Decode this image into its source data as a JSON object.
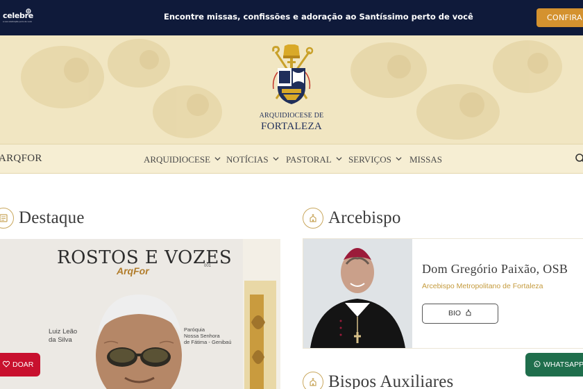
{
  "topbar": {
    "logo_text": "celebre",
    "logo_tagline": "a sua celebração perto de você",
    "promo_text": "Encontre missas, confissões e adoração ao Santíssimo perto de você",
    "cta_label": "CONFIRA"
  },
  "hero": {
    "org_line1": "ARQUIDIOCESE DE",
    "org_line2": "FORTALEZA"
  },
  "nav": {
    "brand": "ARQFOR",
    "items": [
      {
        "label": "ARQUIDIOCESE",
        "has_dropdown": true
      },
      {
        "label": "NOTÍCIAS",
        "has_dropdown": true
      },
      {
        "label": "PASTORAL",
        "has_dropdown": true
      },
      {
        "label": "SERVIÇOS",
        "has_dropdown": true
      },
      {
        "label": "MISSAS",
        "has_dropdown": false
      }
    ]
  },
  "sections": {
    "featured_title": "Destaque",
    "archbishop_title": "Arcebispo",
    "auxiliary_title": "Bispos Auxiliares"
  },
  "featured": {
    "title": "ROSTOS E VOZES",
    "subtitle": "ArqFor",
    "issue": "001",
    "person_name_line1": "Luiz Leão",
    "person_name_line2": "da Silva",
    "parish_line1": "Paróquia",
    "parish_line2": "Nossa Senhora",
    "parish_line3": "de Fátima - Genibaú"
  },
  "archbishop": {
    "name": "Dom Gregório Paixão, OSB",
    "role": "Arcebispo Metropolitano de Fortaleza",
    "bio_label": "BIO"
  },
  "floating": {
    "donate_label": "DOAR",
    "whatsapp_label": "WHATSAPP"
  },
  "colors": {
    "topbar_bg": "#0f1a3a",
    "accent_gold": "#c49a3c",
    "cta_orange": "#d4922f",
    "hero_bg": "#f1e6c2",
    "donate_red": "#c8102e",
    "whatsapp_green": "#1f6e4c"
  }
}
